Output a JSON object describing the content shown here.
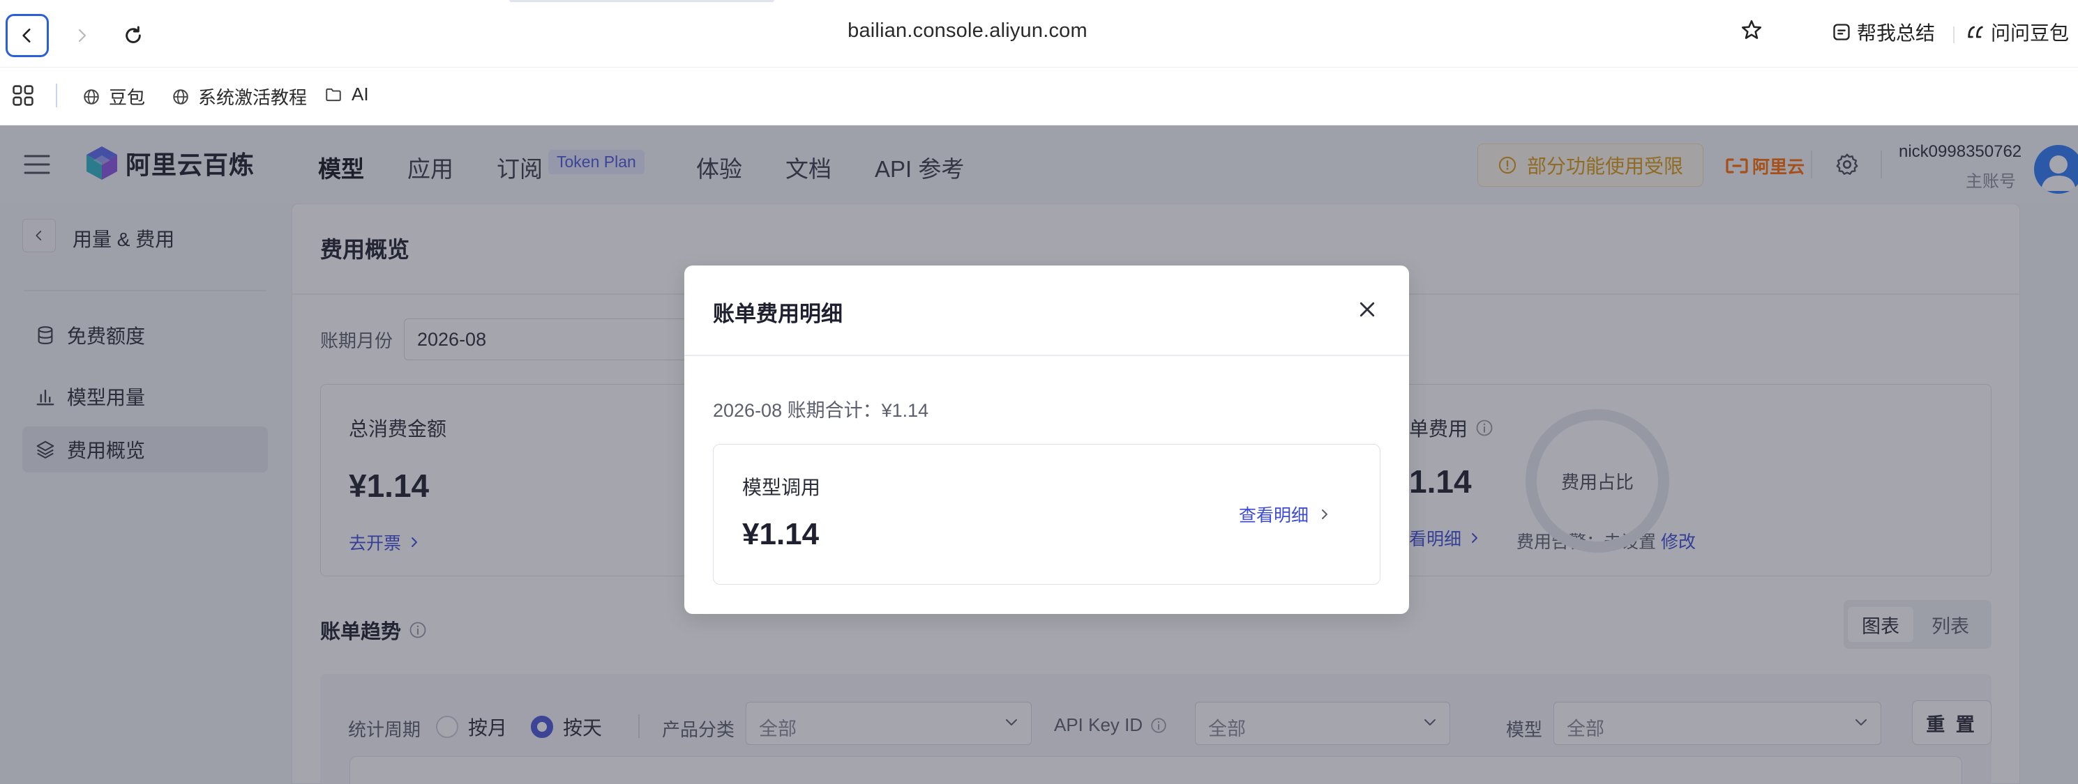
{
  "browser": {
    "url": "bailian.console.aliyun.com",
    "summary_label": "帮我总结",
    "ask_label": "问问豆包",
    "bookmarks": [
      {
        "label": "豆包",
        "icon": "globe-icon"
      },
      {
        "label": "系统激活教程",
        "icon": "globe-icon"
      },
      {
        "label": "AI",
        "icon": "folder-icon"
      }
    ]
  },
  "topnav": {
    "brand": "阿里云百炼",
    "menu": [
      "模型",
      "应用",
      "订阅",
      "体验",
      "文档",
      "API 参考"
    ],
    "token_badge": "Token Plan",
    "warning": "部分功能使用受限",
    "aliyun": "阿里云",
    "user_name": "nick0998350762",
    "user_role": "主账号"
  },
  "sidebar": {
    "title": "用量 & 费用",
    "items": [
      {
        "label": "免费额度",
        "icon": "database-icon"
      },
      {
        "label": "模型用量",
        "icon": "bar-chart-icon"
      },
      {
        "label": "费用概览",
        "icon": "layers-icon"
      }
    ]
  },
  "main": {
    "title": "费用概览",
    "period_label": "账期月份",
    "period_value": "2026-08",
    "total_label": "总消费金额",
    "total_amount": "¥1.14",
    "invoice_link": "去开票",
    "bill_label": "单费用",
    "bill_amount": "1.14",
    "detail_link_partial": "看明细",
    "alert_label": "费用告警：未设置",
    "alert_edit": "修改",
    "ring_label": "费用占比",
    "trend_title": "账单趋势",
    "view_chart": "图表",
    "view_list": "列表",
    "filters": {
      "period_label": "统计周期",
      "by_month": "按月",
      "by_day": "按天",
      "product_label": "产品分类",
      "product_value": "全部",
      "apikey_label": "API Key ID",
      "apikey_value": "全部",
      "model_label": "模型",
      "model_value": "全部",
      "reset": "重 置"
    }
  },
  "modal": {
    "title": "账单费用明细",
    "total": "2026-08 账期合计：¥1.14",
    "item_label": "模型调用",
    "item_amount": "¥1.14",
    "item_link": "查看明细"
  },
  "colors": {
    "accent": "#4a56d6",
    "link": "#3d4cd8",
    "warning": "#d99a14",
    "aliyun_orange": "#ff6a00"
  }
}
